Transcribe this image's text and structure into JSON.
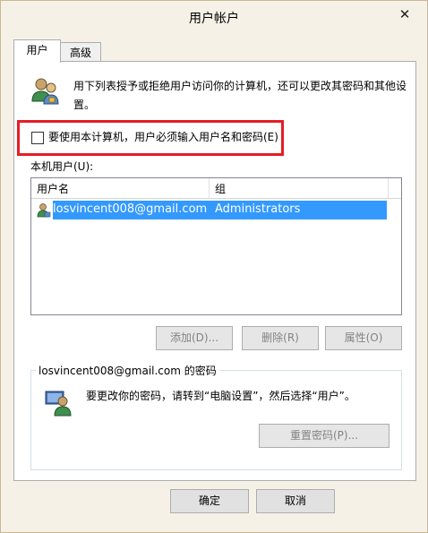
{
  "window": {
    "title": "用户帐户",
    "close_glyph": "✕"
  },
  "tabs": [
    {
      "label": "用户"
    },
    {
      "label": "高级"
    }
  ],
  "description": "用下列表授予或拒绝用户访问你的计算机，还可以更改其密码和其他设置。",
  "require_login": {
    "checked": false,
    "label": "要使用本计算机，用户必须输入用户名和密码(E)"
  },
  "local_users": {
    "label": "本机用户(U):",
    "columns": [
      "用户名",
      "组"
    ],
    "rows": [
      {
        "user": "losvincent008@gmail.com",
        "group": "Administrators",
        "selected": true
      }
    ]
  },
  "user_buttons": {
    "add": "添加(D)...",
    "remove": "删除(R)",
    "properties": "属性(O)"
  },
  "password_group": {
    "title": "losvincent008@gmail.com 的密码",
    "text": "要更改你的密码，请转到“电脑设置”，然后选择“用户”。",
    "reset_button": "重置密码(P)..."
  },
  "footer": {
    "ok": "确定",
    "cancel": "取消"
  },
  "colors": {
    "selection": "#3399ff",
    "highlight_box": "#e51d24"
  }
}
